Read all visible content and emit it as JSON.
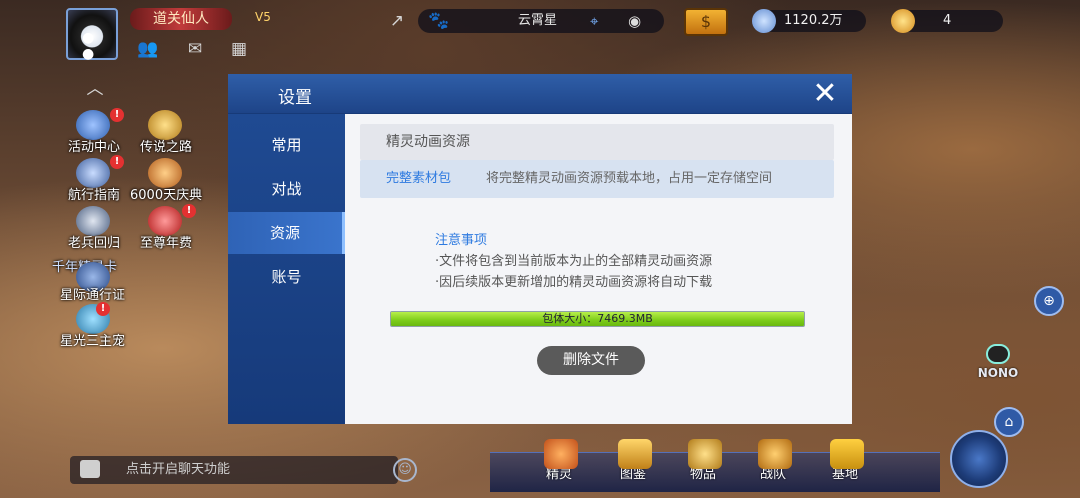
{
  "hud": {
    "username": "道关仙人",
    "vs_text": "V5",
    "planet_name": "云霄星",
    "currency1": "1120.2万",
    "currency2": "4"
  },
  "left_menu": [
    {
      "label": "活动中心"
    },
    {
      "label": "传说之路"
    },
    {
      "label": "航行指南"
    },
    {
      "label": "6000天庆典"
    },
    {
      "label": "老兵回归"
    },
    {
      "label": "至尊年费"
    },
    {
      "label": "千年精灵卡"
    },
    {
      "label": "星际通行证"
    },
    {
      "label": "星光三主宠"
    }
  ],
  "chat": {
    "placeholder": "点击开启聊天功能"
  },
  "bottom_nav": [
    {
      "label": "精灵"
    },
    {
      "label": "图鉴"
    },
    {
      "label": "物品"
    },
    {
      "label": "战队"
    },
    {
      "label": "基地"
    }
  ],
  "nono_label": "NONO",
  "dialog": {
    "title": "设置",
    "tabs": [
      {
        "label": "常用",
        "active": false
      },
      {
        "label": "对战",
        "active": false
      },
      {
        "label": "资源",
        "active": true
      },
      {
        "label": "账号",
        "active": false
      }
    ],
    "section_title": "精灵动画资源",
    "option": {
      "label": "完整素材包",
      "description": "将完整精灵动画资源预载本地，占用一定存储空间"
    },
    "notice": {
      "title": "注意事项",
      "lines": [
        "·文件将包含到当前版本为止的全部精灵动画资源",
        "·因后续版本更新增加的精灵动画资源将自动下载"
      ]
    },
    "progress": {
      "text": "包体大小：7469.3MB",
      "fraction": 1.0
    },
    "delete_button": "删除文件"
  },
  "colors": {
    "accent_blue": "#2f7be0",
    "progress_green": "#7ccc1a",
    "header_blue": "#2f5ea8"
  }
}
